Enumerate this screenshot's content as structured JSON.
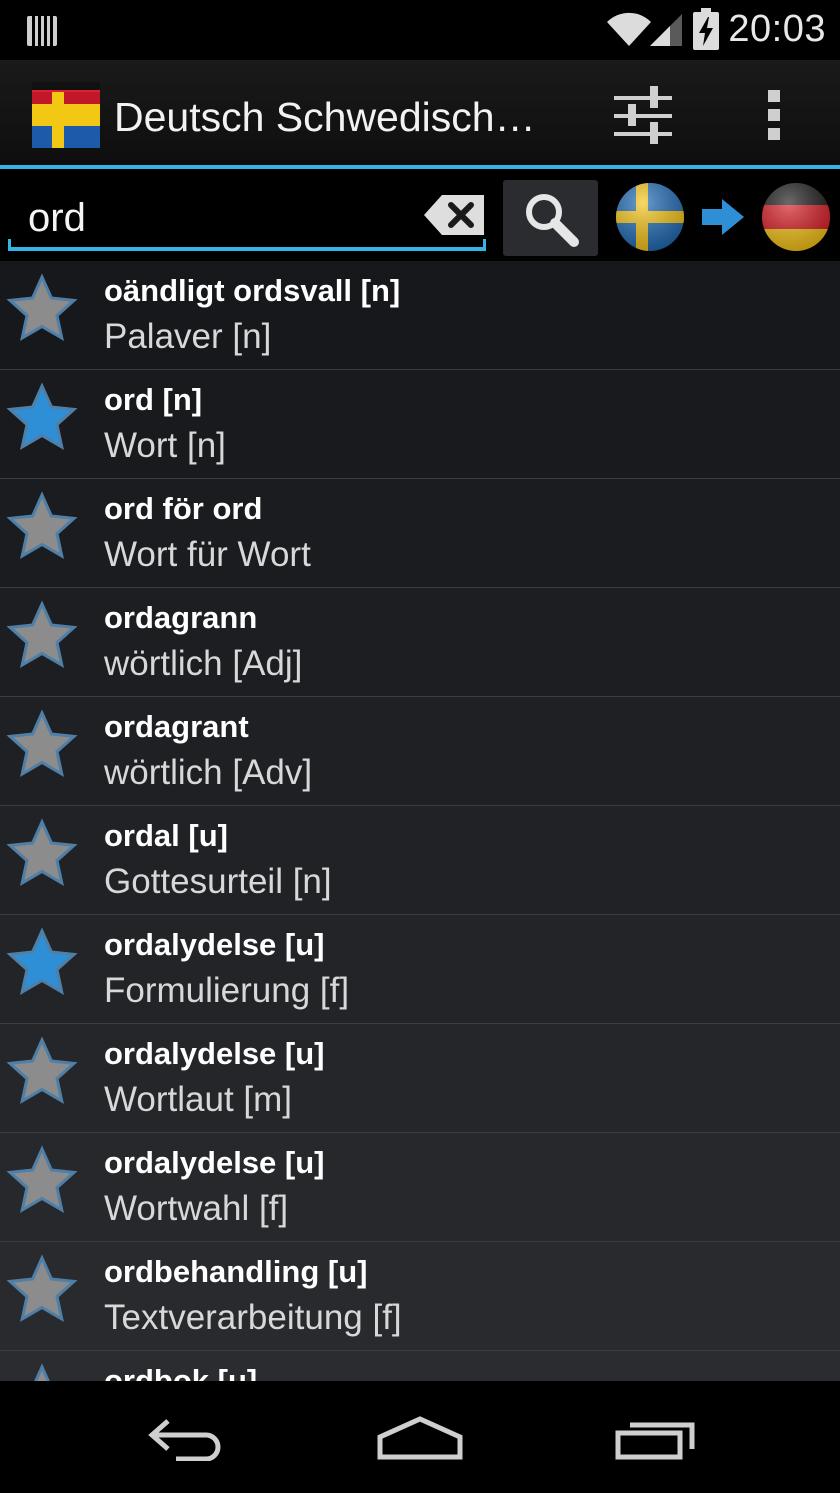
{
  "status_bar": {
    "time": "20:03"
  },
  "action_bar": {
    "title": "Deutsch Schwedisch…"
  },
  "search": {
    "query": "ord"
  },
  "colors": {
    "accent": "#33b5e5",
    "star_active": "#2e8fd6",
    "star_inactive": "#8c8c8c"
  },
  "results": [
    {
      "word": "oändligt ordsvall [n]",
      "translation": "Palaver [n]",
      "favorite": false
    },
    {
      "word": "ord [n]",
      "translation": "Wort [n]",
      "favorite": true
    },
    {
      "word": "ord för ord",
      "translation": "Wort für Wort",
      "favorite": false
    },
    {
      "word": "ordagrann",
      "translation": "wörtlich [Adj]",
      "favorite": false
    },
    {
      "word": "ordagrant",
      "translation": "wörtlich [Adv]",
      "favorite": false
    },
    {
      "word": "ordal [u]",
      "translation": "Gottesurteil [n]",
      "favorite": false
    },
    {
      "word": "ordalydelse [u]",
      "translation": "Formulierung [f]",
      "favorite": true
    },
    {
      "word": "ordalydelse [u]",
      "translation": "Wortlaut [m]",
      "favorite": false
    },
    {
      "word": "ordalydelse [u]",
      "translation": "Wortwahl [f]",
      "favorite": false
    },
    {
      "word": "ordbehandling [u]",
      "translation": "Textverarbeitung [f]",
      "favorite": false
    },
    {
      "word": "ordbok [u]",
      "translation": "",
      "favorite": false
    }
  ]
}
